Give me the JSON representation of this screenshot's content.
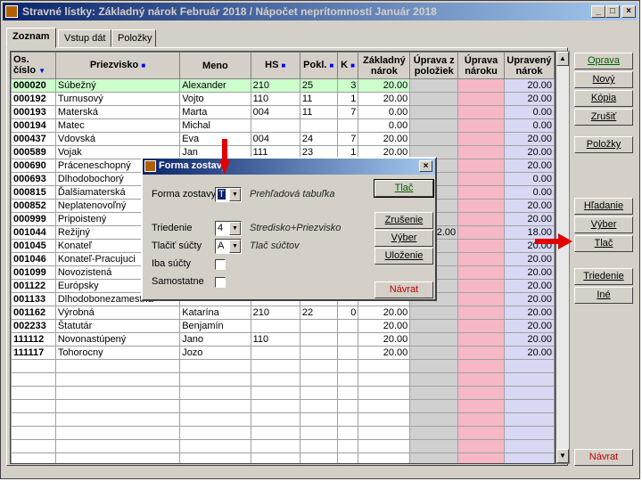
{
  "window": {
    "title": "Stravné lístky:  Základný nárok Február 2018  /  Nápočet neprítomností Január 2018",
    "min": "_",
    "max": "□",
    "close": "×"
  },
  "tabs": [
    {
      "label": "Zoznam"
    },
    {
      "label": "Vstup dát"
    },
    {
      "label": "Položky"
    }
  ],
  "grid": {
    "headers": {
      "os_cislo": "Os. číslo",
      "priezvisko": "Priezvisko",
      "meno": "Meno",
      "hs": "HS",
      "pokl": "Pokl.",
      "k": "K",
      "zakladny_narok": "Základný nárok",
      "uprava_z_poloziek": "Úprava z položiek",
      "uprava_naroku": "Úprava nároku",
      "upraveny_narok": "Upravený nárok"
    },
    "rows": [
      {
        "os": "000020",
        "pr": "Súbežný",
        "me": "Alexander",
        "hs": "210",
        "po": "25",
        "k": "3",
        "zn": "20.00",
        "uz": "",
        "un": "",
        "upn": "20.00"
      },
      {
        "os": "000192",
        "pr": "Turnusový",
        "me": "Vojto",
        "hs": "110",
        "po": "11",
        "k": "1",
        "zn": "20.00",
        "uz": "",
        "un": "",
        "upn": "20.00"
      },
      {
        "os": "000193",
        "pr": "Materská",
        "me": "Marta",
        "hs": "004",
        "po": "11",
        "k": "7",
        "zn": "0.00",
        "uz": "",
        "un": "",
        "upn": "0.00"
      },
      {
        "os": "000194",
        "pr": "Matec",
        "me": "Michal",
        "hs": "",
        "po": "",
        "k": "",
        "zn": "0.00",
        "uz": "",
        "un": "",
        "upn": "0.00"
      },
      {
        "os": "000437",
        "pr": "Vdovská",
        "me": "Eva",
        "hs": "004",
        "po": "24",
        "k": "7",
        "zn": "20.00",
        "uz": "",
        "un": "",
        "upn": "20.00"
      },
      {
        "os": "000589",
        "pr": "Vojak",
        "me": "Jan",
        "hs": "111",
        "po": "23",
        "k": "1",
        "zn": "20.00",
        "uz": "",
        "un": "",
        "upn": "20.00"
      },
      {
        "os": "000690",
        "pr": "Práceneschopný",
        "me": "",
        "hs": "",
        "po": "",
        "k": "",
        "zn": "",
        "uz": "",
        "un": "",
        "upn": "20.00"
      },
      {
        "os": "000693",
        "pr": "Dlhodobochorý",
        "me": "",
        "hs": "",
        "po": "",
        "k": "",
        "zn": "",
        "uz": "",
        "un": "",
        "upn": "0.00"
      },
      {
        "os": "000815",
        "pr": "Ďalšiamaterská",
        "me": "",
        "hs": "",
        "po": "",
        "k": "",
        "zn": "",
        "uz": "",
        "un": "",
        "upn": "0.00"
      },
      {
        "os": "000852",
        "pr": "Neplatenovoľný",
        "me": "",
        "hs": "",
        "po": "",
        "k": "",
        "zn": "",
        "uz": "",
        "un": "",
        "upn": "20.00"
      },
      {
        "os": "000999",
        "pr": "Pripoistený",
        "me": "",
        "hs": "",
        "po": "",
        "k": "",
        "zn": "",
        "uz": "",
        "un": "",
        "upn": "20.00"
      },
      {
        "os": "001044",
        "pr": "Režijný",
        "me": "",
        "hs": "",
        "po": "",
        "k": "",
        "zn": "",
        "uz": "2.00",
        "un": "",
        "upn": "18.00"
      },
      {
        "os": "001045",
        "pr": "Konateľ",
        "me": "",
        "hs": "",
        "po": "",
        "k": "",
        "zn": "",
        "uz": "",
        "un": "",
        "upn": "20.00"
      },
      {
        "os": "001046",
        "pr": "Konateľ-Pracujuci",
        "me": "",
        "hs": "",
        "po": "",
        "k": "",
        "zn": "",
        "uz": "",
        "un": "",
        "upn": "20.00"
      },
      {
        "os": "001099",
        "pr": "Novozistená",
        "me": "",
        "hs": "",
        "po": "",
        "k": "",
        "zn": "",
        "uz": "",
        "un": "",
        "upn": "20.00"
      },
      {
        "os": "001122",
        "pr": "Európsky",
        "me": "",
        "hs": "",
        "po": "",
        "k": "",
        "zn": "",
        "uz": "",
        "un": "",
        "upn": "20.00"
      },
      {
        "os": "001133",
        "pr": "Dlhodobonezamestna",
        "me": "",
        "hs": "",
        "po": "",
        "k": "",
        "zn": "",
        "uz": "",
        "un": "",
        "upn": "20.00"
      },
      {
        "os": "001162",
        "pr": "Výrobná",
        "me": "Katarína",
        "hs": "210",
        "po": "22",
        "k": "0",
        "zn": "20.00",
        "uz": "",
        "un": "",
        "upn": "20.00"
      },
      {
        "os": "002233",
        "pr": "Štatutár",
        "me": "Benjamín",
        "hs": "",
        "po": "",
        "k": "",
        "zn": "20.00",
        "uz": "",
        "un": "",
        "upn": "20.00"
      },
      {
        "os": "111112",
        "pr": "Novonastúpený",
        "me": "Jano",
        "hs": "110",
        "po": "",
        "k": "",
        "zn": "20.00",
        "uz": "",
        "un": "",
        "upn": "20.00"
      },
      {
        "os": "111117",
        "pr": "Tohorocny",
        "me": "Jozo",
        "hs": "",
        "po": "",
        "k": "",
        "zn": "20.00",
        "uz": "",
        "un": "",
        "upn": "20.00"
      }
    ],
    "empty_rows": 8
  },
  "right_buttons": {
    "oprava": "Oprava",
    "novy": "Nový",
    "kopia": "Kópia",
    "zrusit": "Zrušiť",
    "polozky": "Položky",
    "hladanie": "Hľadanie",
    "vyber": "Výber",
    "tlac": "Tlač",
    "triedenie": "Triedenie",
    "ine": "Iné",
    "navrat": "Návrat"
  },
  "dialog": {
    "title": "Forma zostavy",
    "close": "×",
    "forma_label": "Forma zostavy",
    "forma_value": "T",
    "forma_hint": "Prehľadová tabuľka",
    "triedenie_label": "Triedenie",
    "triedenie_value": "4",
    "triedenie_hint": "Stredisko+Priezvisko",
    "tlacit_sucty_label": "Tlačiť súčty",
    "tlacit_sucty_value": "A",
    "tlacit_sucty_hint": "Tlač súčtov",
    "iba_sucty_label": "Iba súčty",
    "samostatne_label": "Samostatne",
    "btn_tlac": "Tlač",
    "btn_zrusenie": "Zrušenie",
    "btn_vyber": "Výber",
    "btn_ulozenie": "Uloženie",
    "btn_navrat": "Návrat"
  },
  "colors": {
    "title_gradient_start": "#0a246a",
    "selected_row": "#ccffcc",
    "uprava_naroku_col": "#f5b8c4",
    "upraveny_narok_col": "#d8d8f4",
    "annotation_arrow": "#e00000"
  }
}
